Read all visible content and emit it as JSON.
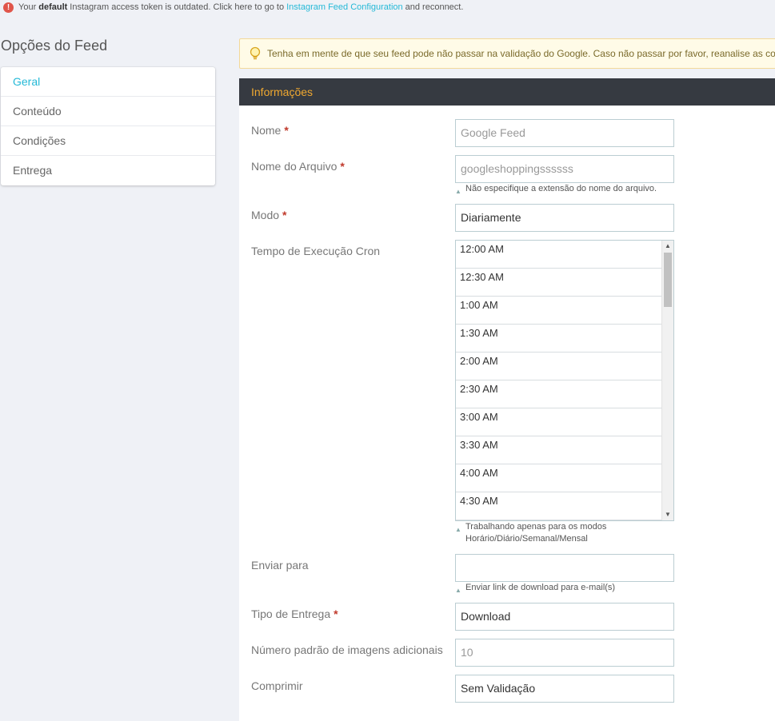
{
  "alert": {
    "pre": "Your",
    "bold": "default",
    "mid": "Instagram access token is outdated. Click here to go to",
    "link": "Instagram Feed Configuration",
    "post": "and reconnect."
  },
  "sidebar": {
    "title": "Opções do Feed",
    "items": [
      "Geral",
      "Conteúdo",
      "Condições",
      "Entrega"
    ],
    "active": "Geral"
  },
  "warning": {
    "text": "Tenha em mente de que seu feed pode não passar na validação do Google. Caso não passar por favor, reanalise as configurações"
  },
  "panel": {
    "title": "Informações",
    "fields": {
      "nome": {
        "label": "Nome",
        "value": "Google Feed"
      },
      "arquivo": {
        "label": "Nome do Arquivo",
        "value": "googleshoppingssssss",
        "help": "Não especifique a extensão do nome do arquivo."
      },
      "modo": {
        "label": "Modo",
        "value": "Diariamente"
      },
      "cron": {
        "label": "Tempo de Execução Cron",
        "help_line1": "Trabalhando apenas para os modos",
        "help_line2": "Horário/Diário/Semanal/Mensal",
        "options": [
          "12:00 AM",
          "12:30 AM",
          "1:00 AM",
          "1:30 AM",
          "2:00 AM",
          "2:30 AM",
          "3:00 AM",
          "3:30 AM",
          "4:00 AM",
          "4:30 AM"
        ]
      },
      "enviar": {
        "label": "Enviar para",
        "value": "",
        "help": "Enviar link de download para e-mail(s)"
      },
      "tipo": {
        "label": "Tipo de Entrega",
        "value": "Download"
      },
      "imagens": {
        "label": "Número padrão de imagens adicionais",
        "value": "10"
      },
      "comprimir": {
        "label": "Comprimir",
        "value": "Sem Validação"
      }
    },
    "required_mark": "*"
  },
  "colors": {
    "accent": "#25b9d7",
    "header_bg": "#363a41",
    "header_text": "#f0a830",
    "required": "#c0392b"
  }
}
